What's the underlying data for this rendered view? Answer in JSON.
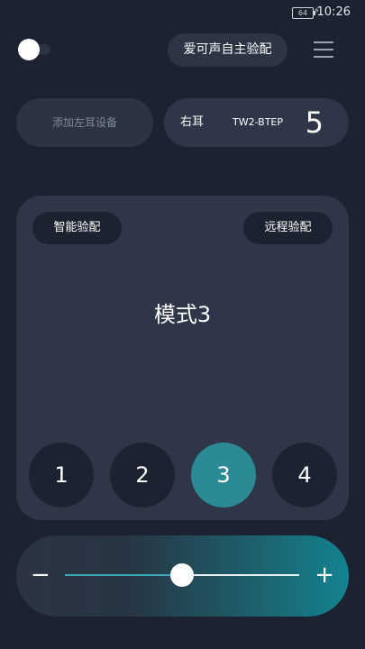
{
  "status": {
    "battery": "64",
    "charging_icon": "lightning-icon",
    "time": "10:26"
  },
  "header": {
    "toggle_on": false,
    "title": "爱可声自主验配",
    "menu_icon": "hamburger-icon"
  },
  "devices": {
    "left": {
      "label": "添加左耳设备"
    },
    "right": {
      "label": "右耳",
      "model": "TW2-BTEP",
      "number": "5"
    }
  },
  "mode_panel": {
    "smart_label": "智能验配",
    "remote_label": "远程验配",
    "current_mode": "模式3",
    "modes": [
      "1",
      "2",
      "3",
      "4"
    ],
    "active_index": 2,
    "active_color": "#2b8a96"
  },
  "volume": {
    "minus": "−",
    "plus": "+",
    "level": 0.5,
    "accent": "#138390"
  }
}
